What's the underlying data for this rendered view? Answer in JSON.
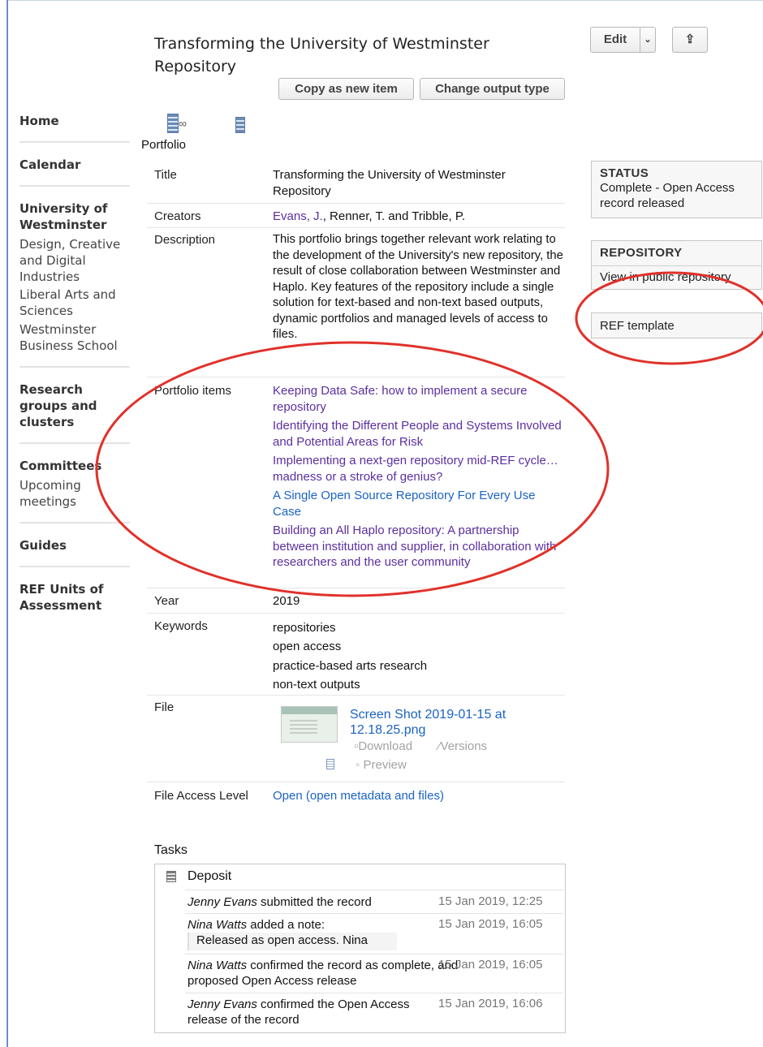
{
  "header": {
    "title": "Transforming the University of Westminster Repository",
    "edit_label": "Edit",
    "edit_dropdown_glyph": "⌄",
    "export_glyph": "⇪",
    "copy_label": "Copy as new item",
    "change_label": "Change output type"
  },
  "sidebar": {
    "home": "Home",
    "calendar": "Calendar",
    "uow": "University of Westminster",
    "uow_children": [
      "Design, Creative and Digital Industries",
      "Liberal Arts and Sciences",
      "Westminster Business School"
    ],
    "research": "Research groups and clusters",
    "committees": "Committees",
    "committees_children": [
      "Upcoming meetings"
    ],
    "guides": "Guides",
    "ref_units": "REF Units of Assessment"
  },
  "record": {
    "type_label": "Portfolio",
    "title_label": "Title",
    "title_value": "Transforming the University of Westminster Repository",
    "creators_label": "Creators",
    "creator_link": "Evans, J.",
    "creators_rest": ", Renner, T. and Tribble, P.",
    "description_label": "Description",
    "description_value": "This portfolio brings together relevant work relating to the development of the University's new repository, the result of close collaboration between Westminster and Haplo. Key features of the repository include a single solution for text-based and non-text based outputs, dynamic portfolios and managed levels of access to files.",
    "portfolio_label": "Portfolio items",
    "portfolio_items": [
      "Keeping Data Safe: how to implement a secure repository",
      "Identifying the Different People and Systems Involved and Potential Areas for Risk",
      "Implementing a next-gen repository mid-REF cycle…madness or a stroke of genius?",
      "A Single Open Source Repository For Every Use Case",
      "Building an All Haplo repository: A partnership between institution and supplier, in collaboration with researchers and the user community"
    ],
    "year_label": "Year",
    "year_value": "2019",
    "keywords_label": "Keywords",
    "keywords": [
      "repositories",
      "open access",
      "practice-based arts research",
      "non-text outputs"
    ],
    "file_label": "File",
    "file_name": "Screen Shot 2019-01-15 at 12.18.25.png",
    "download_label": "Download",
    "versions_label": "Versions",
    "preview_label": "Preview",
    "access_label": "File Access Level",
    "access_value": "Open (open metadata and files)"
  },
  "status": {
    "heading": "STATUS",
    "text": "Complete - Open Access record released"
  },
  "repository": {
    "heading": "REPOSITORY",
    "view_link": "View in public repository",
    "ref_template": "REF template"
  },
  "tasks": {
    "heading": "Tasks",
    "task_name": "Deposit",
    "events": [
      {
        "actor": "Jenny Evans",
        "action": " submitted the record",
        "date": "15 Jan 2019, 12:25"
      },
      {
        "actor": "Nina Watts",
        "action": " added a note:",
        "date": "15 Jan 2019, 16:05"
      },
      {
        "actor": "Nina Watts",
        "action": " confirmed the record as complete, and proposed Open Access release",
        "date": "15 Jan 2019, 16:05"
      },
      {
        "actor": "Jenny Evans",
        "action": " confirmed the Open Access release of the record",
        "date": "15 Jan 2019, 16:06"
      }
    ],
    "note": "Released as open access. Nina"
  },
  "colors": {
    "annotation": "#e0312a",
    "link_purple": "#5b2fa0",
    "link_blue": "#1b63c4"
  }
}
